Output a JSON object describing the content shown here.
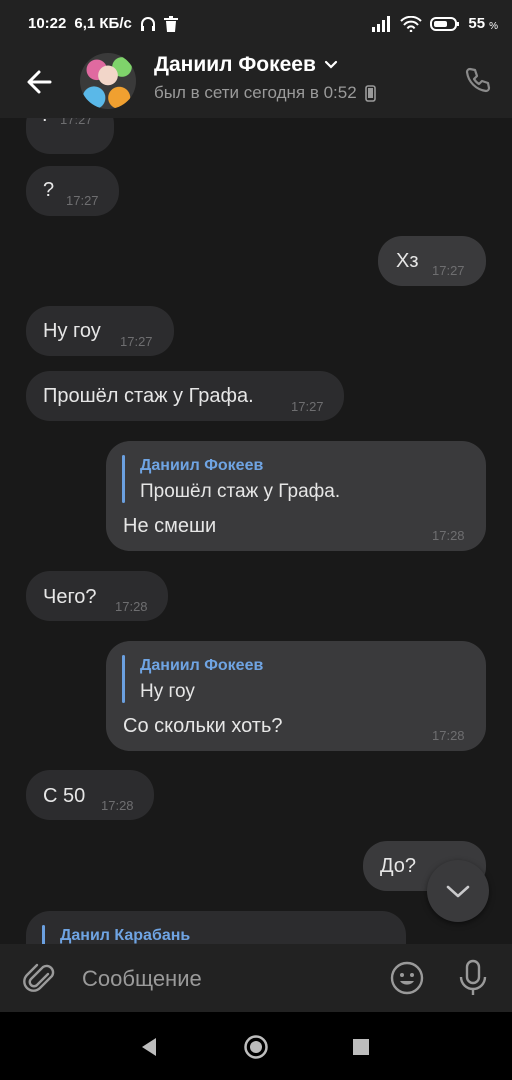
{
  "status_bar": {
    "time": "10:22",
    "net_speed": "6,1 КБ/с",
    "battery": "55",
    "battery_unit": "%"
  },
  "header": {
    "contact_name": "Даниил Фокеев",
    "last_seen": "был в сети сегодня в 0:52"
  },
  "messages": [
    {
      "direction": "in",
      "text": "!",
      "time": "17:27"
    },
    {
      "direction": "in",
      "text": "?",
      "time": "17:27"
    },
    {
      "direction": "out",
      "text": "Хз",
      "time": "17:27"
    },
    {
      "direction": "in",
      "text": "Ну гоу",
      "time": "17:27"
    },
    {
      "direction": "in",
      "text": "Прошёл стаж у Графа.",
      "time": "17:27"
    },
    {
      "direction": "out",
      "quote_author": "Даниил Фокеев",
      "quote_text": "Прошёл стаж у Графа.",
      "text": "Не смеши",
      "time": "17:28"
    },
    {
      "direction": "in",
      "text": "Чего?",
      "time": "17:28"
    },
    {
      "direction": "out",
      "quote_author": "Даниил Фокеев",
      "quote_text": "Ну гоу",
      "text": "Со скольки хоть?",
      "time": "17:28"
    },
    {
      "direction": "in",
      "text": "С 50",
      "time": "17:28"
    },
    {
      "direction": "out",
      "text": "До?",
      "time": ""
    },
    {
      "direction": "in",
      "quote_author": "Данил Карабань",
      "quote_text": "",
      "text": "",
      "time": ""
    }
  ],
  "composer": {
    "placeholder": "Сообщение"
  },
  "icons": {
    "back": "arrow-left-icon",
    "call": "phone-icon",
    "attach": "paperclip-icon",
    "emoji": "smiley-icon",
    "mic": "microphone-icon",
    "scroll_down": "chevron-down-icon"
  },
  "colors": {
    "background": "#191919",
    "bar": "#222222",
    "bubble_in": "#2c2c2e",
    "bubble_out": "#3a3a3c",
    "quote_accent": "#6fa4e3"
  }
}
